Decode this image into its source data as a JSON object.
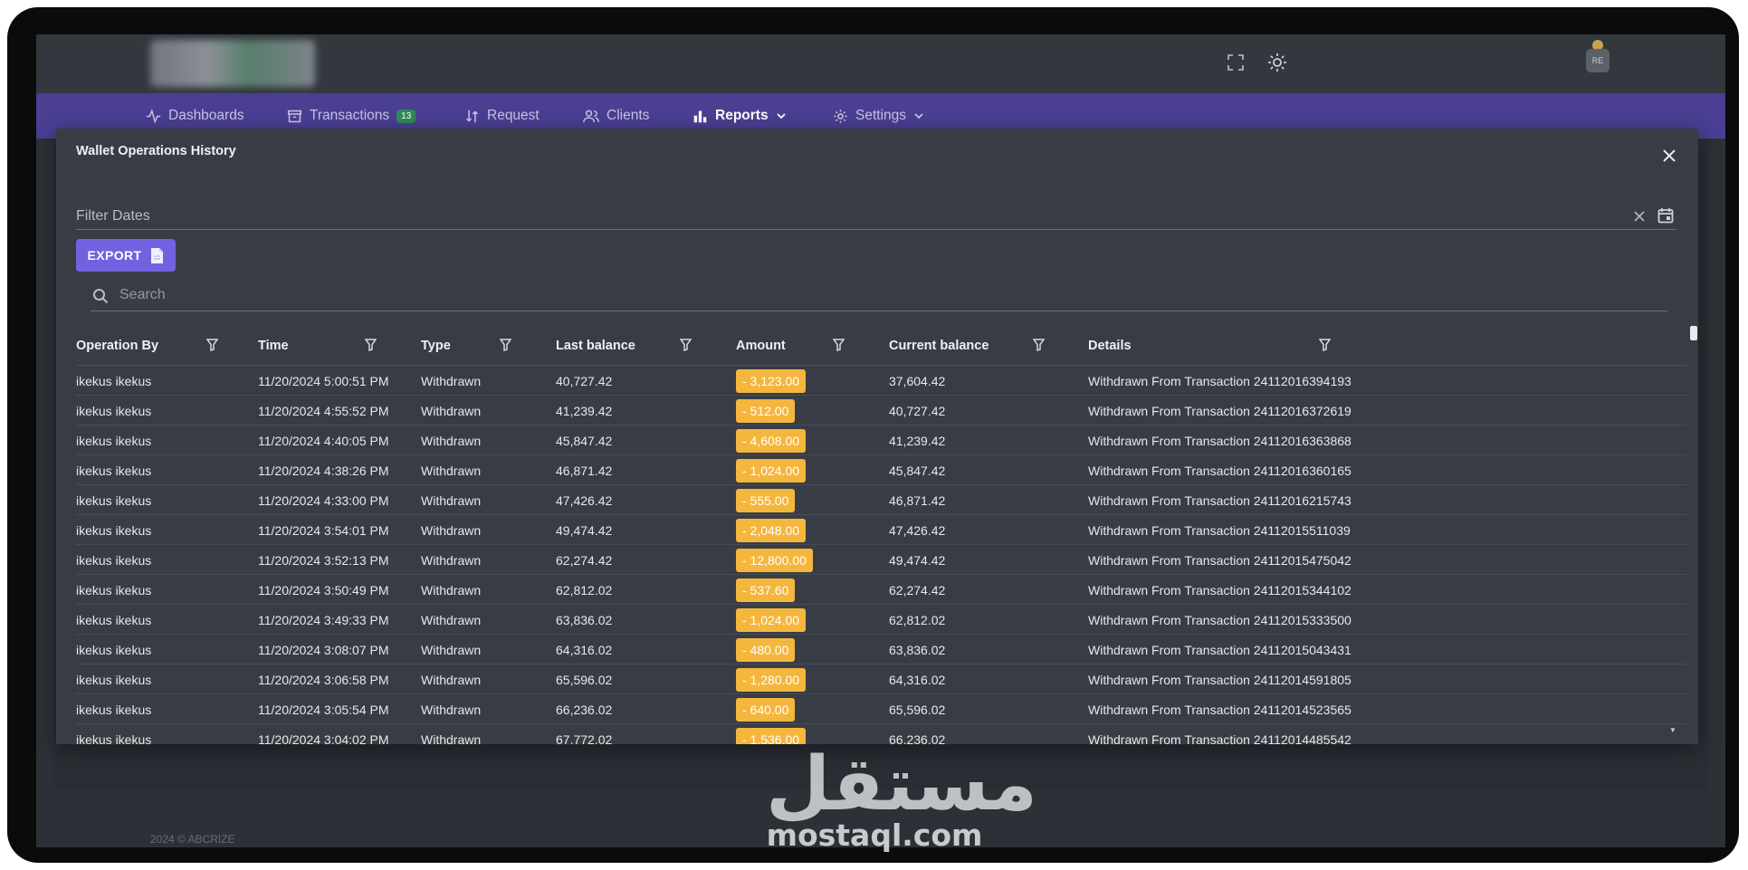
{
  "nav": {
    "items": [
      {
        "label": "Dashboards",
        "icon": "activity-icon"
      },
      {
        "label": "Transactions",
        "icon": "archive-icon",
        "badge": "13"
      },
      {
        "label": "Request",
        "icon": "swap-icon"
      },
      {
        "label": "Clients",
        "icon": "users-icon"
      },
      {
        "label": "Reports",
        "icon": "bar-chart-icon",
        "active": true
      },
      {
        "label": "Settings",
        "icon": "gear-icon"
      }
    ]
  },
  "topbar": {
    "avatar_initials": "RE"
  },
  "modal": {
    "title": "Wallet Operations History",
    "filter_label": "Filter Dates",
    "export_label": "EXPORT",
    "search_placeholder": "Search"
  },
  "table": {
    "columns": [
      "Operation By",
      "Time",
      "Type",
      "Last balance",
      "Amount",
      "Current balance",
      "Details"
    ],
    "rows": [
      {
        "by": "ikekus  ikekus",
        "time": "11/20/2024 5:00:51 PM",
        "type": "Withdrawn",
        "last": "40,727.42",
        "amount": "- 3,123.00",
        "current": "37,604.42",
        "details": "Withdrawn From Transaction 24112016394193"
      },
      {
        "by": "ikekus  ikekus",
        "time": "11/20/2024 4:55:52 PM",
        "type": "Withdrawn",
        "last": "41,239.42",
        "amount": "- 512.00",
        "current": "40,727.42",
        "details": "Withdrawn From Transaction 24112016372619"
      },
      {
        "by": "ikekus  ikekus",
        "time": "11/20/2024 4:40:05 PM",
        "type": "Withdrawn",
        "last": "45,847.42",
        "amount": "- 4,608.00",
        "current": "41,239.42",
        "details": "Withdrawn From Transaction 24112016363868"
      },
      {
        "by": "ikekus  ikekus",
        "time": "11/20/2024 4:38:26 PM",
        "type": "Withdrawn",
        "last": "46,871.42",
        "amount": "- 1,024.00",
        "current": "45,847.42",
        "details": "Withdrawn From Transaction 24112016360165"
      },
      {
        "by": "ikekus  ikekus",
        "time": "11/20/2024 4:33:00 PM",
        "type": "Withdrawn",
        "last": "47,426.42",
        "amount": "- 555.00",
        "current": "46,871.42",
        "details": "Withdrawn From Transaction 24112016215743"
      },
      {
        "by": "ikekus  ikekus",
        "time": "11/20/2024 3:54:01 PM",
        "type": "Withdrawn",
        "last": "49,474.42",
        "amount": "- 2,048.00",
        "current": "47,426.42",
        "details": "Withdrawn From Transaction 24112015511039"
      },
      {
        "by": "ikekus  ikekus",
        "time": "11/20/2024 3:52:13 PM",
        "type": "Withdrawn",
        "last": "62,274.42",
        "amount": "- 12,800.00",
        "current": "49,474.42",
        "details": "Withdrawn From Transaction 24112015475042"
      },
      {
        "by": "ikekus  ikekus",
        "time": "11/20/2024 3:50:49 PM",
        "type": "Withdrawn",
        "last": "62,812.02",
        "amount": "- 537.60",
        "current": "62,274.42",
        "details": "Withdrawn From Transaction 24112015344102"
      },
      {
        "by": "ikekus  ikekus",
        "time": "11/20/2024 3:49:33 PM",
        "type": "Withdrawn",
        "last": "63,836.02",
        "amount": "- 1,024.00",
        "current": "62,812.02",
        "details": "Withdrawn From Transaction 24112015333500"
      },
      {
        "by": "ikekus  ikekus",
        "time": "11/20/2024 3:08:07 PM",
        "type": "Withdrawn",
        "last": "64,316.02",
        "amount": "- 480.00",
        "current": "63,836.02",
        "details": "Withdrawn From Transaction 24112015043431"
      },
      {
        "by": "ikekus  ikekus",
        "time": "11/20/2024 3:06:58 PM",
        "type": "Withdrawn",
        "last": "65,596.02",
        "amount": "- 1,280.00",
        "current": "64,316.02",
        "details": "Withdrawn From Transaction 24112014591805"
      },
      {
        "by": "ikekus  ikekus",
        "time": "11/20/2024 3:05:54 PM",
        "type": "Withdrawn",
        "last": "66,236.02",
        "amount": "- 640.00",
        "current": "65,596.02",
        "details": "Withdrawn From Transaction 24112014523565"
      },
      {
        "by": "ikekus  ikekus",
        "time": "11/20/2024 3:04:02 PM",
        "type": "Withdrawn",
        "last": "67,772.02",
        "amount": "- 1,536.00",
        "current": "66,236.02",
        "details": "Withdrawn From Transaction 24112014485542"
      }
    ]
  },
  "footer": {
    "copyright": "2024 © ABCRIZE"
  },
  "watermark": {
    "arabic": "مستقل",
    "latin": "mostaql.com"
  },
  "colors": {
    "navbar": "#4a3f93",
    "export_button": "#7162e0",
    "amount_badge": "#f5b63e",
    "modal_bg": "#383d45"
  }
}
